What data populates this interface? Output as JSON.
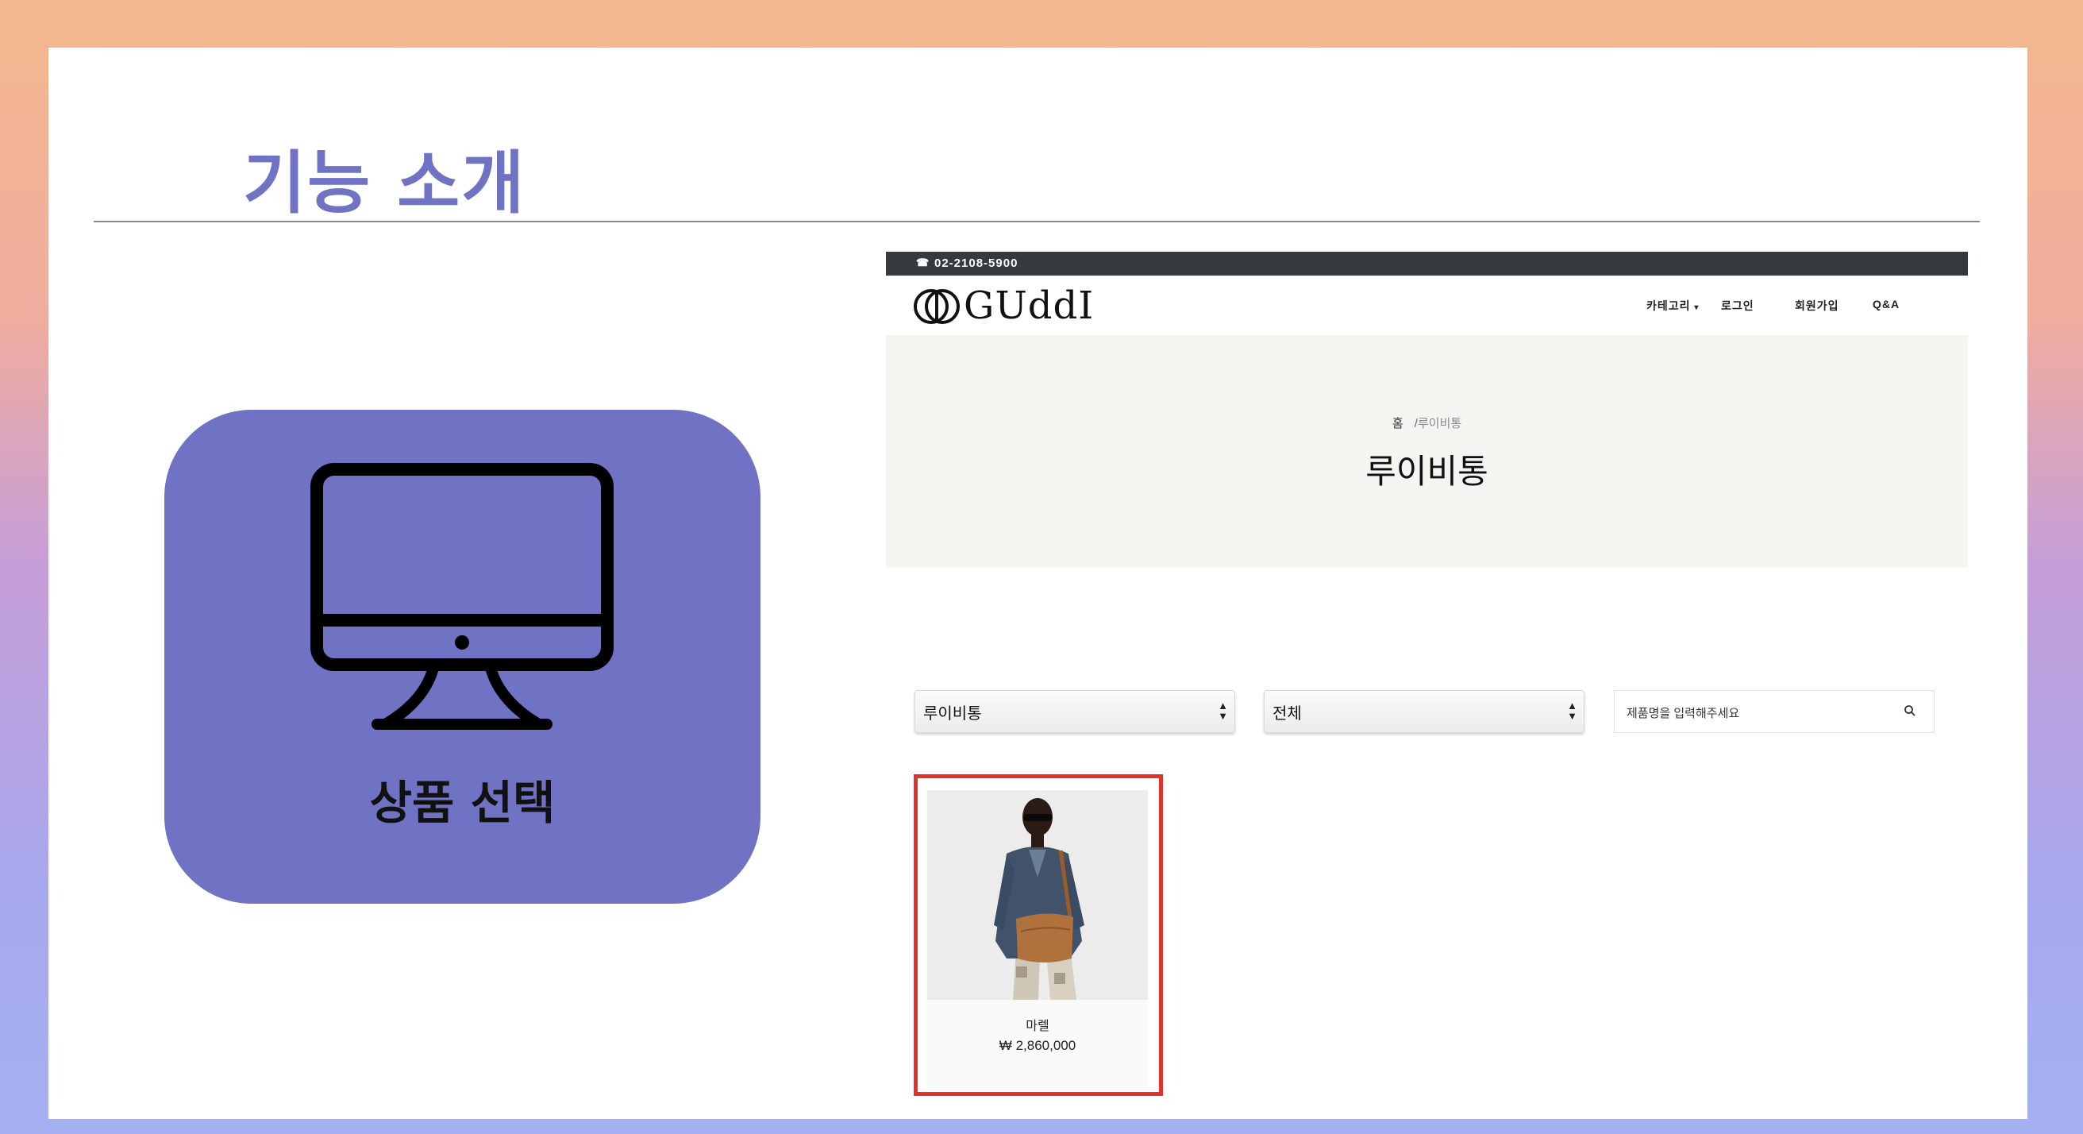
{
  "slide": {
    "title": "기능 소개",
    "feature_label": "상품 선택"
  },
  "site": {
    "phone": "02-2108-5900",
    "logo_text": "GUddI",
    "nav": {
      "category": "카테고리",
      "login": "로그인",
      "signup": "회원가입",
      "qna": "Q&A"
    },
    "breadcrumb": {
      "home": "홈",
      "separator": "/",
      "current": "루이비통"
    },
    "page_title": "루이비통",
    "filters": {
      "brand_select": "루이비통",
      "category_select": "전체",
      "search_placeholder": "제품명을 입력해주세요"
    },
    "products": [
      {
        "name": "마렐",
        "price": "₩ 2,860,000"
      }
    ]
  },
  "colors": {
    "accent_purple": "#7072c4",
    "highlight_red": "#e0312a",
    "topbar": "#353a3f",
    "hero_bg": "#f5f4f1"
  }
}
